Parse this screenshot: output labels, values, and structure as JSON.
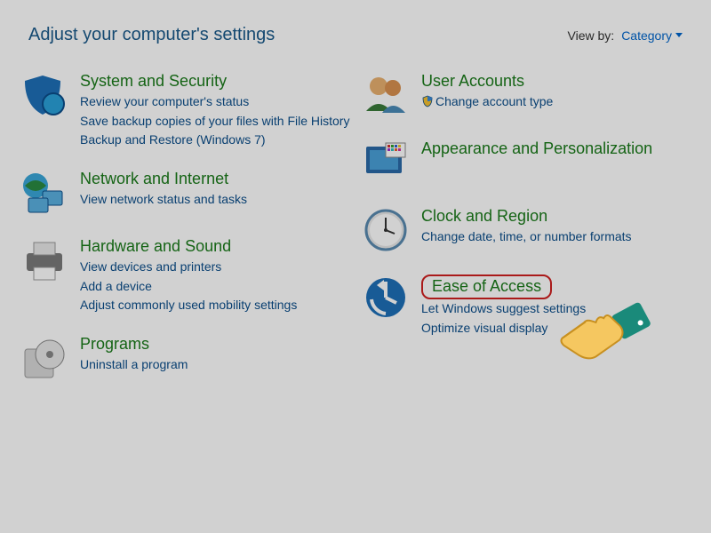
{
  "header": {
    "title": "Adjust your computer's settings",
    "viewby_label": "View by:",
    "viewby_value": "Category"
  },
  "left": [
    {
      "icon": "shield-icon",
      "title": "System and Security",
      "links": [
        "Review your computer's status",
        "Save backup copies of your files with File History",
        "Backup and Restore (Windows 7)"
      ]
    },
    {
      "icon": "network-icon",
      "title": "Network and Internet",
      "links": [
        "View network status and tasks"
      ]
    },
    {
      "icon": "printer-icon",
      "title": "Hardware and Sound",
      "links": [
        "View devices and printers",
        "Add a device",
        "Adjust commonly used mobility settings"
      ]
    },
    {
      "icon": "disc-icon",
      "title": "Programs",
      "links": [
        "Uninstall a program"
      ]
    }
  ],
  "right": [
    {
      "icon": "users-icon",
      "title": "User Accounts",
      "links": [
        "Change account type"
      ],
      "shielded": true
    },
    {
      "icon": "monitor-icon",
      "title": "Appearance and Personalization",
      "links": []
    },
    {
      "icon": "clock-icon",
      "title": "Clock and Region",
      "links": [
        "Change date, time, or number formats"
      ]
    },
    {
      "icon": "ease-icon",
      "title": "Ease of Access",
      "links": [
        "Let Windows suggest settings",
        "Optimize visual display"
      ],
      "highlighted": true
    }
  ]
}
